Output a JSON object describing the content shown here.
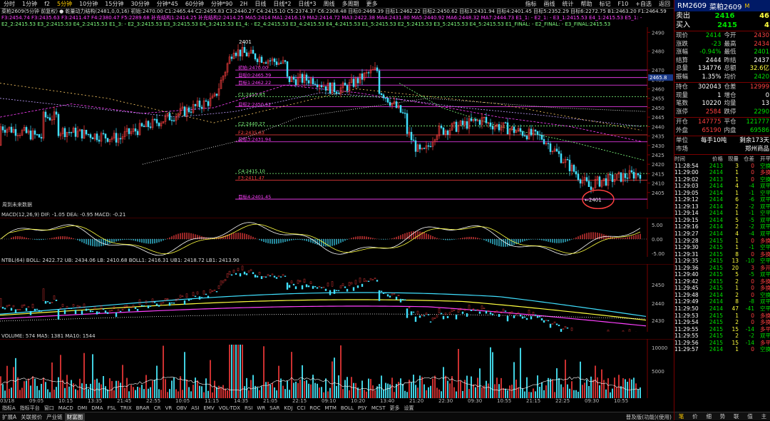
{
  "toolbar": {
    "items": [
      "分时",
      "1分钟",
      "f2",
      "5分钟",
      "10分钟",
      "15分钟",
      "30分钟",
      "分钟*45",
      "60分钟",
      "分钟*90",
      "2H",
      "日线",
      "日线*2",
      "日线*3",
      "周线",
      "多周期",
      "更多"
    ],
    "active_index": 3,
    "right_items": [
      "指标",
      "画线",
      "统计",
      "帮助",
      "标记",
      "F10",
      "+自选",
      "返回"
    ]
  },
  "legend": {
    "main_line1": "菜粕2609(5分钟 前复权) ● 乾量动力结构(2481,0,0,16) 初始:2470.00 C1:2465.44 C2:2455.83 C3:2440.27 C4:2415.10 C5:2374.37 C6:2308.48 目标0:2469.39 目标1:2462.22 目标2:2450.62 目标3:2431.94 目标4:2401.45 目标5:2352.29 目标6:2272.75 B1:2463.20 F1:2464.59",
    "main_line2": "F3:2454.74 F3:2435.63 F3:2411.47 F4:2380.47 F5:2289.68 补充结构1:2414.25 补充结构2:2414.25 MA5:2414 MA1:2416.19 MA2:2414.72 MA3:2422.38 MA4:2431.80 MA5:2440.92 MA6:2448.32 MA7:2444.73 E1_1: - E2_1: - E3_1:2415.53 E4_1:2415.53 E5_1: -",
    "main_line3": "E2_2:2415.53 E3_2:2415.53 E4_2:2415.53 E1_3: - E2_3:2415.53 E3_3:2415.53 E4_3:2415.53 E1_4: - E2_4:2415.53 E3_4:2415.53 E4_4:2415.53 E1_5:2415.53 E2_5:2415.53 E3_5:2415.53 E4_5:2415.53 E1_FINAL: - E2_FINAL: - E3_FINAL:2415.53",
    "macd": "MACD(12,26,9)  DIF: -1.05  DEA: -0.95  MACD: -0.21",
    "ntbl": "NTBL(64)  BOLL: 2422.72  UB: 2434.06  LB: 2410.68  BOLL1: 2416.31  UB1: 2418.72  LB1: 2413.90",
    "volume": "VOLUME: 574  MA5: 1381  MA10: 1544"
  },
  "no_data_label": "周到未来数据",
  "annotation": {
    "value": "2401"
  },
  "peak_label": "2401",
  "level_labels": [
    {
      "text": "初始:2470.00",
      "color": "#ff40ff"
    },
    {
      "text": "目标0:2465.39",
      "color": "#ff40ff"
    },
    {
      "text": "目标1:2462.22",
      "color": "#ff40ff"
    },
    {
      "text": "C1:2455.83",
      "color": "#80ff80"
    },
    {
      "text": "目标2:2450.62",
      "color": "#ff40ff"
    },
    {
      "text": "C2:2440.27",
      "color": "#80ff80"
    },
    {
      "text": "F2:2435.63",
      "color": "#ff4040"
    },
    {
      "text": "目标3:2431.94",
      "color": "#ff40ff"
    },
    {
      "text": "C4:2415.10",
      "color": "#80ff80"
    },
    {
      "text": "F3:2411.47",
      "color": "#ff4040"
    },
    {
      "text": "目标4:2401.45",
      "color": "#ff40ff"
    }
  ],
  "price_ticks": [
    "2490",
    "2480",
    "2470",
    "2465",
    "2460",
    "2455",
    "2450",
    "2445",
    "2440",
    "2435",
    "2430",
    "2425",
    "2420",
    "2415",
    "2410",
    "2405"
  ],
  "current_price_tag": "2465.8",
  "macd_ticks": [
    "5.00",
    "0.00",
    "-5.00"
  ],
  "ntbl_ticks": [
    "2450",
    "2440",
    "2430"
  ],
  "vol_ticks": [
    "10000",
    "5000"
  ],
  "date_labels": [
    "03/18",
    "09:05",
    "10:15",
    "13:35",
    "21:45",
    "22:55",
    "10:05",
    "11:15",
    "14:35",
    "21:05",
    "22:15",
    "09:10",
    "10:20",
    "13:40",
    "21:20",
    "22:30",
    "09:30",
    "10:55",
    "21:15",
    "22:25",
    "09:30",
    "10:55"
  ],
  "subtabs": [
    "指标A",
    "指标平台",
    "窗口",
    "MACD",
    "DMI",
    "DMA",
    "FSL",
    "TRIX",
    "BRAR",
    "CR",
    "VR",
    "OBV",
    "ASI",
    "EMV",
    "VOL-TDX",
    "RSI",
    "WR",
    "SAR",
    "KDJ",
    "CCI",
    "ROC",
    "MTM",
    "BOLL",
    "PSY",
    "MCST",
    "更多",
    "设置"
  ],
  "bottombar": [
    "扩展A",
    "关联报价",
    "产业链",
    "财富图"
  ],
  "bottombar_right": "普及版(功能)(使用)",
  "right_panel": {
    "contract": "RM2609",
    "name": "菜粕2609",
    "mark": "M",
    "sell_label": "卖出",
    "sell_price": "2416",
    "sell_qty": "46",
    "buy_label": "买入",
    "buy_price": "2415",
    "buy_qty": "4",
    "stats": [
      [
        "现价",
        "2414",
        "今开",
        "2430"
      ],
      [
        "涨跌",
        "-23",
        "最高",
        "2434"
      ],
      [
        "涨幅",
        "-0.94%",
        "最低",
        "2401"
      ],
      [
        "结算",
        "2444",
        "昨结",
        "2437"
      ],
      [
        "总量",
        "134776",
        "总额",
        "32.6亿"
      ],
      [
        "振幅",
        "1.35%",
        "均价",
        "2420"
      ]
    ],
    "stats2": [
      [
        "持仓",
        "302043",
        "仓差",
        "12999"
      ],
      [
        "现量",
        "1",
        "增仓",
        "0"
      ],
      [
        "笔数",
        "10220",
        "均量",
        "13"
      ],
      [
        "涨停",
        "2584",
        "跌停",
        "2290"
      ]
    ],
    "stats3": [
      [
        "开仓",
        "147775",
        "平仓",
        "121777"
      ],
      [
        "外盘",
        "65190",
        "内盘",
        "69586"
      ]
    ],
    "unit_label": "单位",
    "unit_value": "每手10吨",
    "fee_value": "剩余173天",
    "market_label": "市场",
    "market_value": "郑州商品",
    "trade_headers": [
      "时间",
      "价格",
      "现量",
      "仓差",
      "开平"
    ],
    "trades": [
      [
        "11:28:54",
        "2413",
        "3",
        "0",
        "空换"
      ],
      [
        "11:29:00",
        "2414",
        "1",
        "0",
        "多换"
      ],
      [
        "11:29:02",
        "2413",
        "1",
        "0",
        "空换"
      ],
      [
        "11:29:03",
        "2414",
        "4",
        "-4",
        "双平"
      ],
      [
        "11:29:05",
        "2414",
        "1",
        "-1",
        "空平"
      ],
      [
        "11:29:12",
        "2414",
        "6",
        "-6",
        "双平"
      ],
      [
        "11:29:13",
        "2414",
        "2",
        "-2",
        "双平"
      ],
      [
        "11:29:14",
        "2414",
        "1",
        "-1",
        "空平"
      ],
      [
        "11:29:15",
        "2414",
        "5",
        "-5",
        "双平"
      ],
      [
        "11:29:16",
        "2414",
        "2",
        "-2",
        "双平"
      ],
      [
        "11:29:27",
        "2414",
        "4",
        "-4",
        "双平"
      ],
      [
        "11:29:28",
        "2415",
        "1",
        "0",
        "多换"
      ],
      [
        "11:29:30",
        "2415",
        "1",
        "-1",
        "空平"
      ],
      [
        "11:29:31",
        "2415",
        "8",
        "0",
        "多换"
      ],
      [
        "11:29:35",
        "2415",
        "13",
        "-10",
        "空平"
      ],
      [
        "11:29:36",
        "2415",
        "20",
        "3",
        "多开"
      ],
      [
        "11:29:40",
        "2415",
        "5",
        "-5",
        "双平"
      ],
      [
        "11:29:42",
        "2415",
        "2",
        "0",
        "多换"
      ],
      [
        "11:29:45",
        "2415",
        "1",
        "0",
        "多换"
      ],
      [
        "11:29:48",
        "2414",
        "2",
        "0",
        "空换"
      ],
      [
        "11:29:49",
        "2414",
        "8",
        "-8",
        "双平"
      ],
      [
        "11:29:50",
        "2414",
        "47",
        "-41",
        "空平"
      ],
      [
        "11:29:53",
        "2415",
        "1",
        "0",
        "多换"
      ],
      [
        "11:29:54",
        "2415",
        "2",
        "0",
        "多换"
      ],
      [
        "11:29:55",
        "2415",
        "15",
        "-14",
        "多平"
      ],
      [
        "11:29:55",
        "2415",
        "2",
        "-2",
        "双平"
      ],
      [
        "11:29:56",
        "2415",
        "15",
        "-14",
        "多平"
      ],
      [
        "11:29:57",
        "2414",
        "1",
        "0",
        "空换"
      ]
    ],
    "footer_tabs": [
      "笔",
      "价",
      "细",
      "势",
      "联",
      "值",
      "主"
    ]
  },
  "colors": {
    "up": "#ff4040",
    "down": "#40e0ff",
    "magenta": "#ff40ff",
    "yellow": "#ffff40",
    "white": "#ffffff",
    "cyan": "#40e0ff"
  }
}
